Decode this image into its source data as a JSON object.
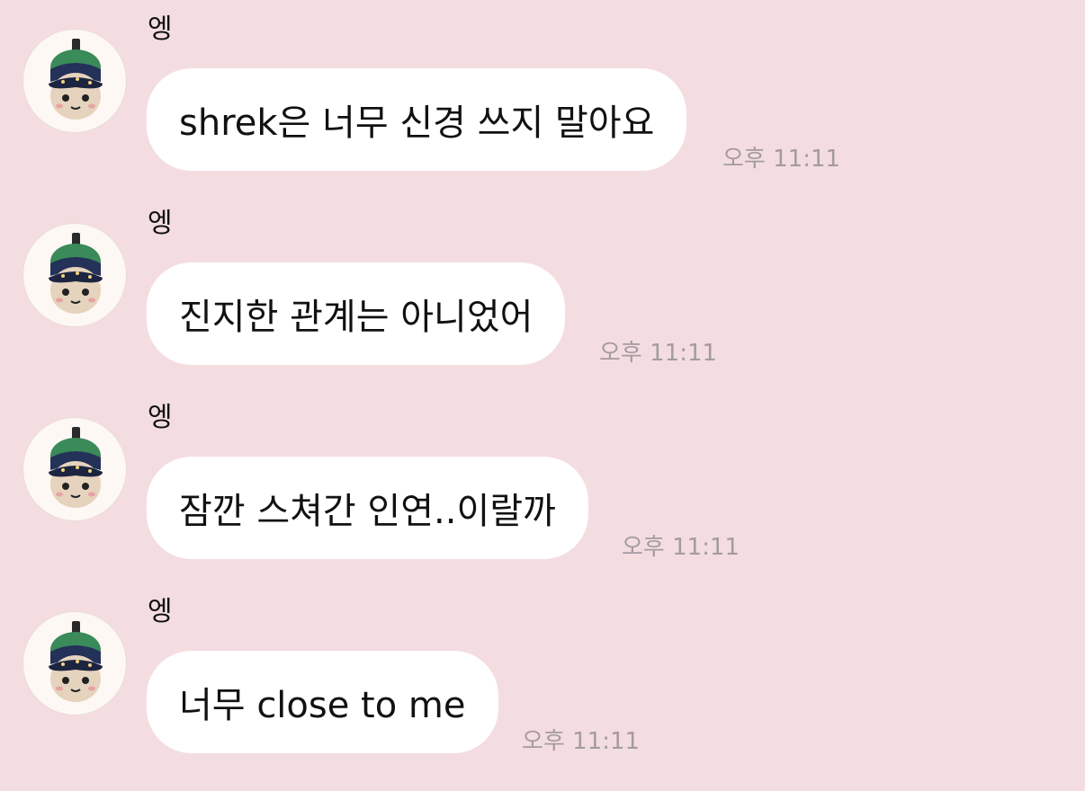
{
  "messages": [
    {
      "sender": "엥",
      "text": "shrek은 너무 신경 쓰지 말아요",
      "time": "오후 11:11"
    },
    {
      "sender": "엥",
      "text": "진지한 관계는 아니었어",
      "time": "오후 11:11"
    },
    {
      "sender": "엥",
      "text": "잠깐 스쳐간 인연..이랄까",
      "time": "오후 11:11"
    },
    {
      "sender": "엥",
      "text": "너무 close to me",
      "time": "오후 11:11"
    }
  ],
  "avatar_icon": "plush-doll-avatar-icon",
  "colors": {
    "background": "#f4dde1",
    "bubble": "#ffffff",
    "timestamp": "#a49ba0"
  }
}
